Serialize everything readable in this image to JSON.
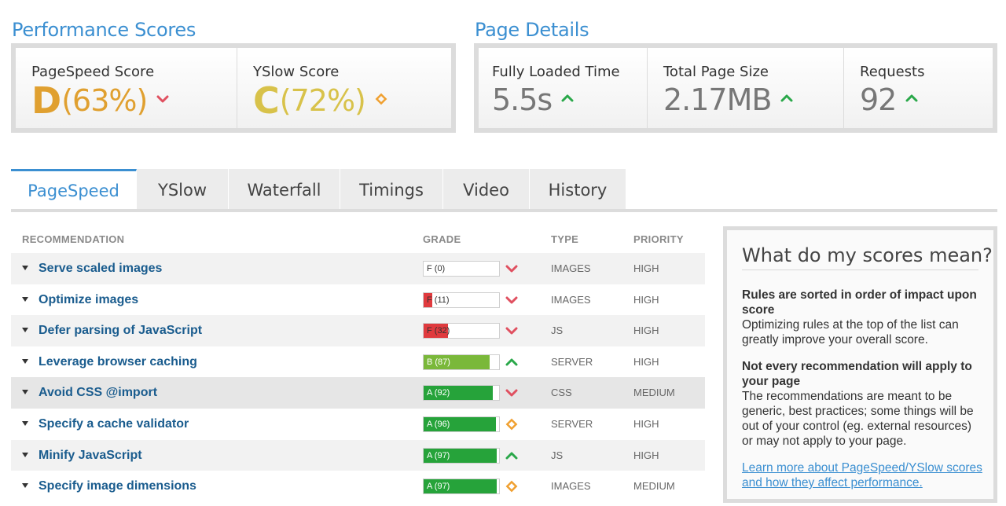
{
  "performance": {
    "title": "Performance Scores",
    "pagespeed": {
      "label": "PageSpeed Score",
      "grade": "D",
      "percent": "(63%)",
      "indicator": "down"
    },
    "yslow": {
      "label": "YSlow Score",
      "grade": "C",
      "percent": "(72%)",
      "indicator": "neutral"
    }
  },
  "details": {
    "title": "Page Details",
    "fully_loaded": {
      "label": "Fully Loaded Time",
      "value": "5.5s",
      "indicator": "up"
    },
    "page_size": {
      "label": "Total Page Size",
      "value": "2.17MB",
      "indicator": "up"
    },
    "requests": {
      "label": "Requests",
      "value": "92",
      "indicator": "up"
    }
  },
  "tabs": [
    {
      "label": "PageSpeed",
      "active": true
    },
    {
      "label": "YSlow",
      "active": false
    },
    {
      "label": "Waterfall",
      "active": false
    },
    {
      "label": "Timings",
      "active": false
    },
    {
      "label": "Video",
      "active": false
    },
    {
      "label": "History",
      "active": false
    }
  ],
  "table": {
    "headers": {
      "recommendation": "RECOMMENDATION",
      "grade": "GRADE",
      "type": "TYPE",
      "priority": "PRIORITY"
    },
    "rows": [
      {
        "name": "Serve scaled images",
        "grade": "F (0)",
        "score": 0,
        "trend": "down",
        "type": "IMAGES",
        "priority": "HIGH"
      },
      {
        "name": "Optimize images",
        "grade": "F (11)",
        "score": 11,
        "trend": "down",
        "type": "IMAGES",
        "priority": "HIGH"
      },
      {
        "name": "Defer parsing of JavaScript",
        "grade": "F (32)",
        "score": 32,
        "trend": "down",
        "type": "JS",
        "priority": "HIGH"
      },
      {
        "name": "Leverage browser caching",
        "grade": "B (87)",
        "score": 87,
        "trend": "up",
        "type": "SERVER",
        "priority": "HIGH"
      },
      {
        "name": "Avoid CSS @import",
        "grade": "A (92)",
        "score": 92,
        "trend": "down",
        "type": "CSS",
        "priority": "MEDIUM"
      },
      {
        "name": "Specify a cache validator",
        "grade": "A (96)",
        "score": 96,
        "trend": "neutral",
        "type": "SERVER",
        "priority": "HIGH"
      },
      {
        "name": "Minify JavaScript",
        "grade": "A (97)",
        "score": 97,
        "trend": "up",
        "type": "JS",
        "priority": "HIGH"
      },
      {
        "name": "Specify image dimensions",
        "grade": "A (97)",
        "score": 97,
        "trend": "neutral",
        "type": "IMAGES",
        "priority": "MEDIUM"
      }
    ]
  },
  "info": {
    "title": "What do my scores mean?",
    "block1_heading": "Rules are sorted in order of impact upon score",
    "block1_text": "Optimizing rules at the top of the list can greatly improve your overall score.",
    "block2_heading": "Not every recommendation will apply to your page",
    "block2_text": "The recommendations are meant to be generic, best practices; some things will be out of your control (eg. external resources) or may not apply to your page.",
    "link": "Learn more about PageSpeed/YSlow scores and how they affect performance."
  },
  "colors": {
    "accent": "#3b8fd1",
    "grade_d": "#e0a030",
    "grade_c": "#d8c24a",
    "grade_f": "#e03a3e",
    "grade_b": "#7ab83a",
    "grade_a": "#26a33a",
    "trend_up": "#2aa84a",
    "trend_down": "#e05060",
    "trend_neutral": "#f0a030"
  },
  "icons": {
    "up": "chevron-up-icon",
    "down": "chevron-down-icon",
    "neutral": "diamond-icon"
  }
}
